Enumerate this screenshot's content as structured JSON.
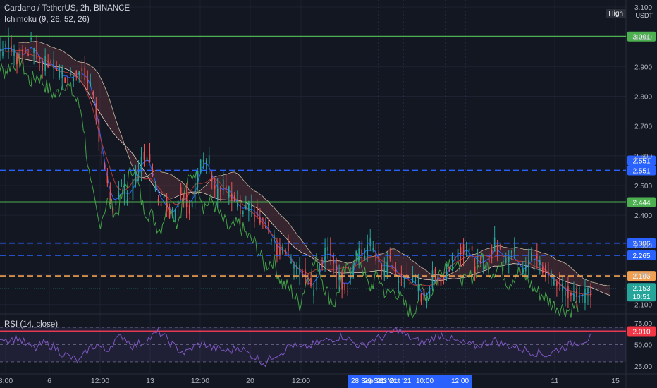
{
  "header": {
    "title": "Cardano / TetherUS, 2h, BINANCE",
    "indicator": "Ichimoku (9, 26, 52, 26)",
    "high_label": "High",
    "currency": "USDT"
  },
  "rsi_panel": {
    "label": "RSI (14, close)"
  },
  "colors": {
    "background": "#131722",
    "grid": "#1e2230",
    "green_line": "#4caf50",
    "red_line": "#f23645",
    "blue_dash": "#2962ff",
    "orange_dash": "#f0a050",
    "candle_up": "#26a69a",
    "candle_down": "#ef5350",
    "rsi_line": "#7e57c2"
  },
  "chart_data": [
    {
      "type": "line",
      "panel": "price",
      "y_ticks": [
        "2.100",
        "2.200",
        "2.300",
        "2.400",
        "2.500",
        "2.600",
        "2.700",
        "2.800",
        "2.900",
        "3.000",
        "3.100"
      ],
      "ylim": [
        2.08,
        3.1
      ],
      "x_ticks": [
        "8:00",
        "6",
        "12:00",
        "13",
        "12:00",
        "20",
        "12:00",
        "11",
        "15"
      ],
      "x_tick_labels_overlap": [
        "28 Sep '21",
        "29 Sep '21",
        "03 Oct '21",
        "10:00",
        "12:00"
      ],
      "horizontal_levels": [
        {
          "value": 3.001,
          "label": "3.001",
          "style": "solid",
          "color": "#4caf50"
        },
        {
          "value": 2.551,
          "label": "2.551",
          "style": "dashed",
          "color": "#2962ff"
        },
        {
          "value": 2.444,
          "label": "2.444",
          "style": "solid",
          "color": "#4caf50"
        },
        {
          "value": 2.306,
          "label": "2.306",
          "style": "dashed",
          "color": "#2962ff"
        },
        {
          "value": 2.265,
          "label": "2.265",
          "style": "dashed",
          "color": "#2962ff"
        },
        {
          "value": 2.196,
          "label": "2.196",
          "style": "dashed",
          "color": "#f0a050"
        },
        {
          "value": 2.01,
          "label": "2.010",
          "style": "solid",
          "color": "#f23645"
        }
      ],
      "extra_badges": [
        {
          "value": 2.551,
          "label": "2.551"
        }
      ],
      "current_price": {
        "value": 2.153,
        "label": "2.153",
        "countdown": "10:51"
      },
      "series": [
        {
          "name": "",
          "values": [
            2.95,
            2.98,
            2.93,
            2.96,
            2.97,
            2.9,
            2.92,
            2.88,
            2.85,
            2.9,
            2.86,
            2.8,
            2.55,
            2.42,
            2.5,
            2.45,
            2.55,
            2.62,
            2.48,
            2.45,
            2.4,
            2.5,
            2.42,
            2.55,
            2.6,
            2.48,
            2.5,
            2.44,
            2.4,
            2.42,
            2.38,
            2.35,
            2.28,
            2.3,
            2.22,
            2.2,
            2.15,
            2.25,
            2.3,
            2.2,
            2.15,
            2.25,
            2.28,
            2.3,
            2.2,
            2.25,
            2.18,
            2.2,
            2.15,
            2.12,
            2.2,
            2.18,
            2.25,
            2.3,
            2.28,
            2.22,
            2.25,
            2.3,
            2.26,
            2.28,
            2.22,
            2.26,
            2.24,
            2.2,
            2.18,
            2.15,
            2.14,
            2.13,
            2.15
          ]
        }
      ]
    },
    {
      "type": "line",
      "panel": "rsi",
      "y_ticks": [
        "25.00",
        "50.00",
        "75.00"
      ],
      "ylim": [
        20,
        80
      ],
      "series": [
        {
          "name": "",
          "values": [
            60,
            55,
            58,
            50,
            45,
            52,
            48,
            40,
            35,
            30,
            45,
            50,
            42,
            55,
            60,
            48,
            52,
            58,
            65,
            55,
            45,
            40,
            48,
            52,
            46,
            44,
            42,
            48,
            40,
            35,
            28,
            38,
            42,
            50,
            45,
            48,
            52,
            55,
            58,
            60,
            52,
            48,
            55,
            58,
            62,
            68,
            60,
            55,
            52,
            58,
            62,
            56,
            52,
            50,
            48,
            52,
            55,
            50,
            48,
            45,
            42,
            40,
            38,
            44,
            48,
            52,
            55,
            58
          ]
        }
      ]
    }
  ]
}
